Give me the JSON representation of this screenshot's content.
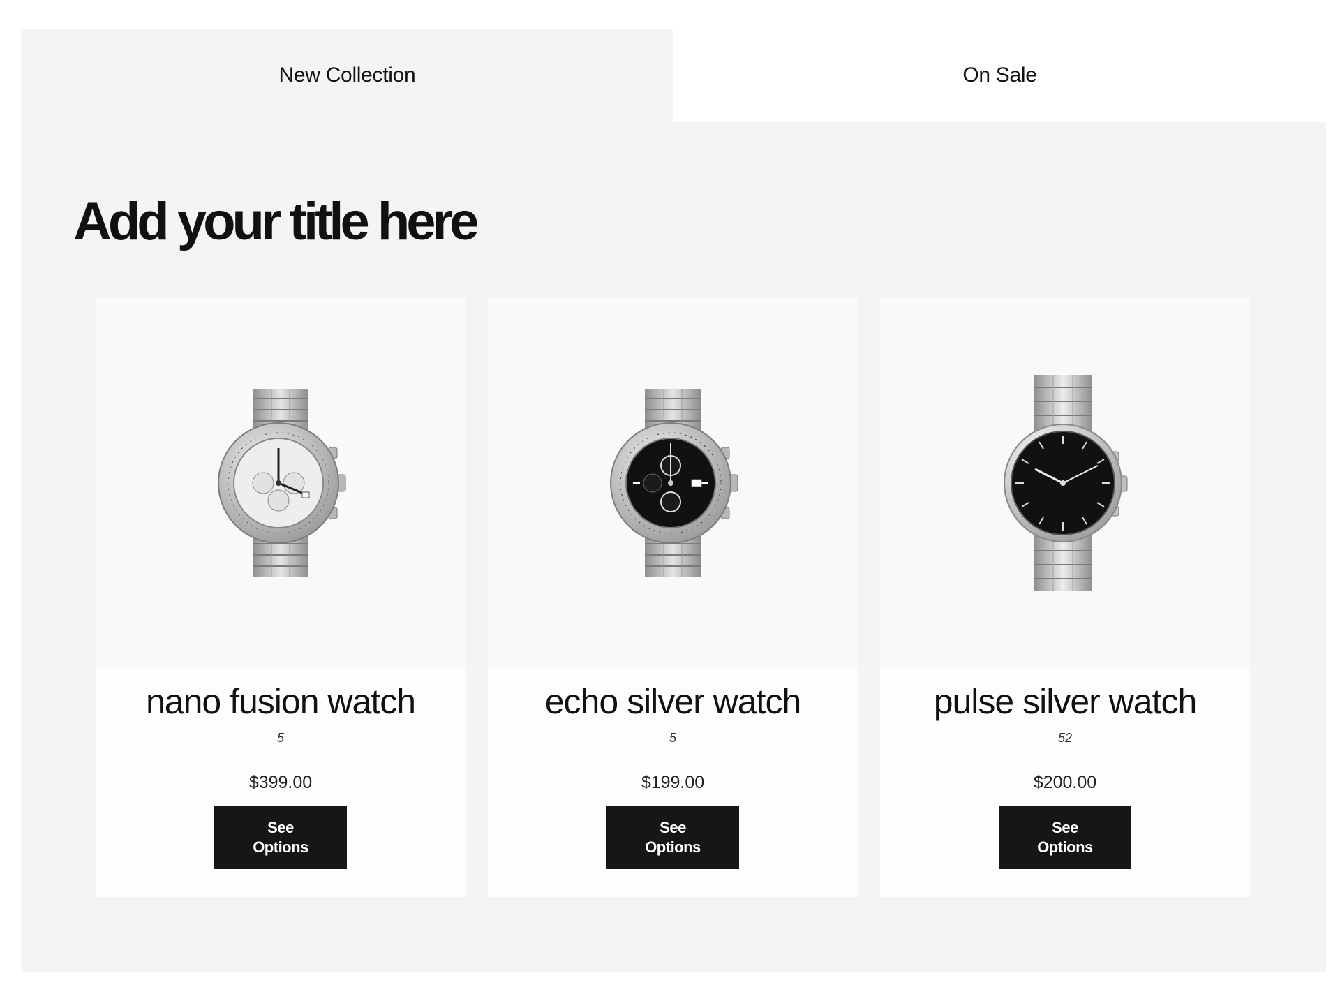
{
  "tabs": [
    {
      "label": "New Collection",
      "active": true
    },
    {
      "label": "On Sale",
      "active": false
    }
  ],
  "section": {
    "title": "Add your title here"
  },
  "products": [
    {
      "name": "nano fusion watch",
      "rating": "5",
      "price": "$399.00",
      "button_label": "See Options",
      "dial_color": "#eeeeee",
      "image": "chronograph-watch-white-dial"
    },
    {
      "name": "echo silver watch",
      "rating": "5",
      "price": "$199.00",
      "button_label": "See Options",
      "dial_color": "#111111",
      "image": "chronograph-watch-black-dial"
    },
    {
      "name": "pulse silver watch",
      "rating": "52",
      "price": "$200.00",
      "button_label": "See Options",
      "dial_color": "#111111",
      "image": "minimalist-watch-black-dial"
    }
  ],
  "colors": {
    "panel_bg": "#f4f4f4",
    "card_bg": "#fdfdfd",
    "button_bg": "#161616",
    "button_text": "#ffffff"
  }
}
